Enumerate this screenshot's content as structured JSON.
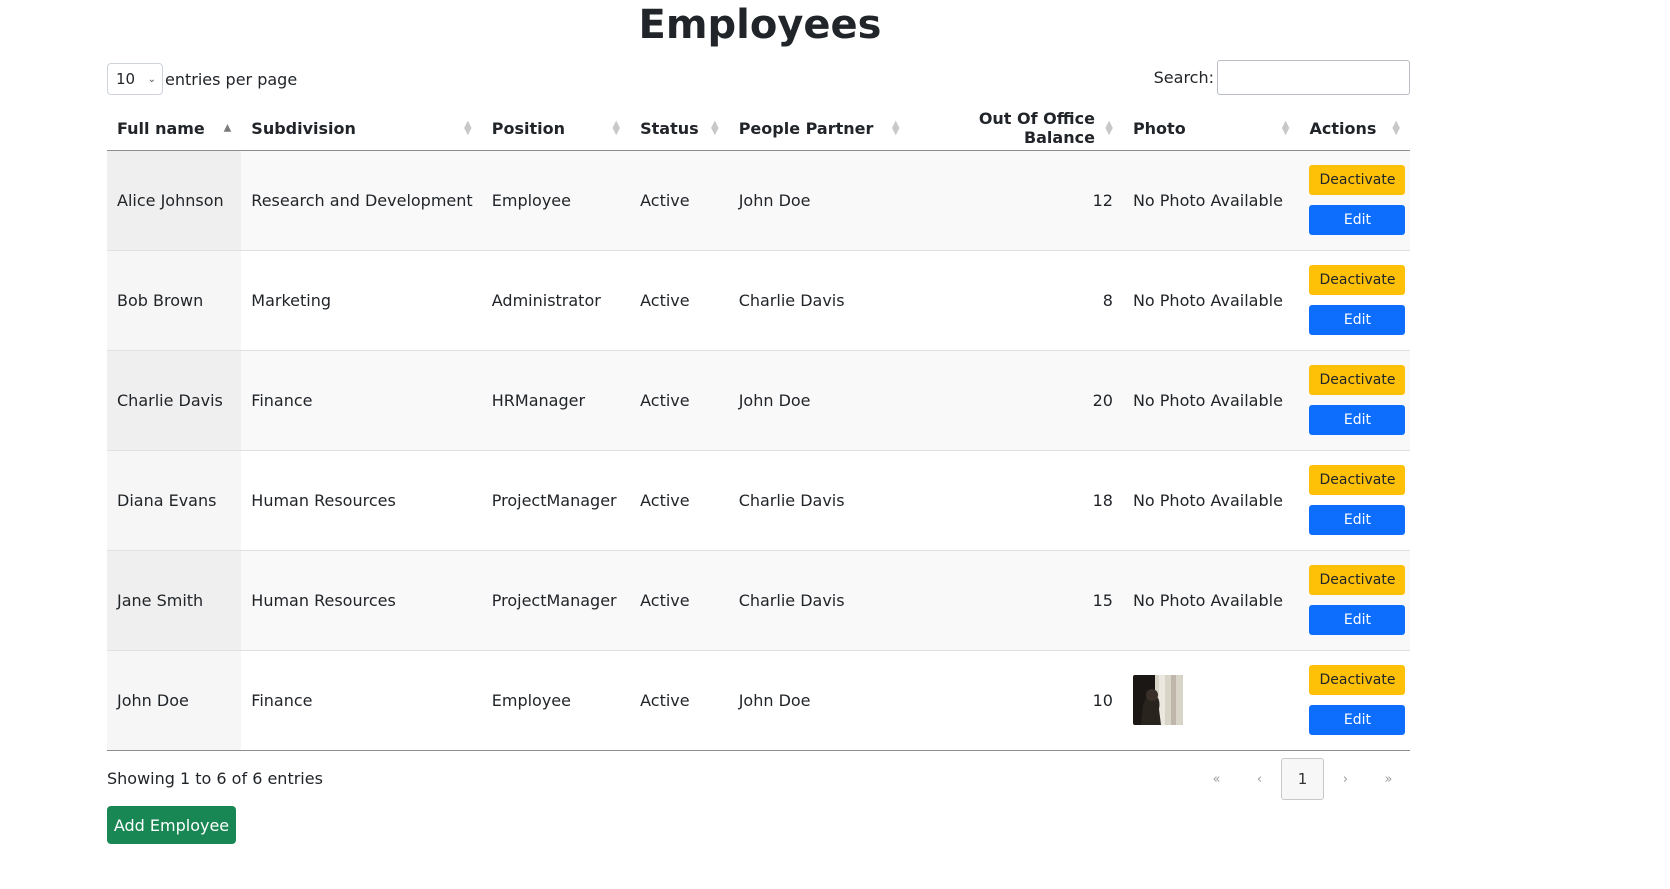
{
  "page": {
    "title": "Employees"
  },
  "length_control": {
    "value": "10",
    "label": "entries per page"
  },
  "search": {
    "label": "Search:",
    "value": "",
    "placeholder": ""
  },
  "table": {
    "columns": [
      "Full name",
      "Subdivision",
      "Position",
      "Status",
      "People Partner",
      "Out Of Office Balance",
      "Photo",
      "Actions"
    ],
    "sorted_column": "Full name",
    "sort_direction": "ascending",
    "rows": [
      {
        "full_name": "Alice Johnson",
        "subdivision": "Research and Development",
        "position": "Employee",
        "status": "Active",
        "people_partner": "John Doe",
        "balance": "12",
        "photo": "No Photo Available",
        "deactivate": "Deactivate",
        "edit": "Edit"
      },
      {
        "full_name": "Bob Brown",
        "subdivision": "Marketing",
        "position": "Administrator",
        "status": "Active",
        "people_partner": "Charlie Davis",
        "balance": "8",
        "photo": "No Photo Available",
        "deactivate": "Deactivate",
        "edit": "Edit"
      },
      {
        "full_name": "Charlie Davis",
        "subdivision": "Finance",
        "position": "HRManager",
        "status": "Active",
        "people_partner": "John Doe",
        "balance": "20",
        "photo": "No Photo Available",
        "deactivate": "Deactivate",
        "edit": "Edit"
      },
      {
        "full_name": "Diana Evans",
        "subdivision": "Human Resources",
        "position": "ProjectManager",
        "status": "Active",
        "people_partner": "Charlie Davis",
        "balance": "18",
        "photo": "No Photo Available",
        "deactivate": "Deactivate",
        "edit": "Edit"
      },
      {
        "full_name": "Jane Smith",
        "subdivision": "Human Resources",
        "position": "ProjectManager",
        "status": "Active",
        "people_partner": "Charlie Davis",
        "balance": "15",
        "photo": "No Photo Available",
        "deactivate": "Deactivate",
        "edit": "Edit"
      },
      {
        "full_name": "John Doe",
        "subdivision": "Finance",
        "position": "Employee",
        "status": "Active",
        "people_partner": "John Doe",
        "balance": "10",
        "photo": "",
        "deactivate": "Deactivate",
        "edit": "Edit"
      }
    ]
  },
  "footer": {
    "info": "Showing 1 to 6 of 6 entries"
  },
  "pagination": {
    "first": "«",
    "prev": "‹",
    "current": "1",
    "next": "›",
    "last": "»"
  },
  "add_button": {
    "label": "Add Employee"
  },
  "colors": {
    "deactivate": "#ffc107",
    "edit": "#0d6efd",
    "add": "#198754"
  }
}
